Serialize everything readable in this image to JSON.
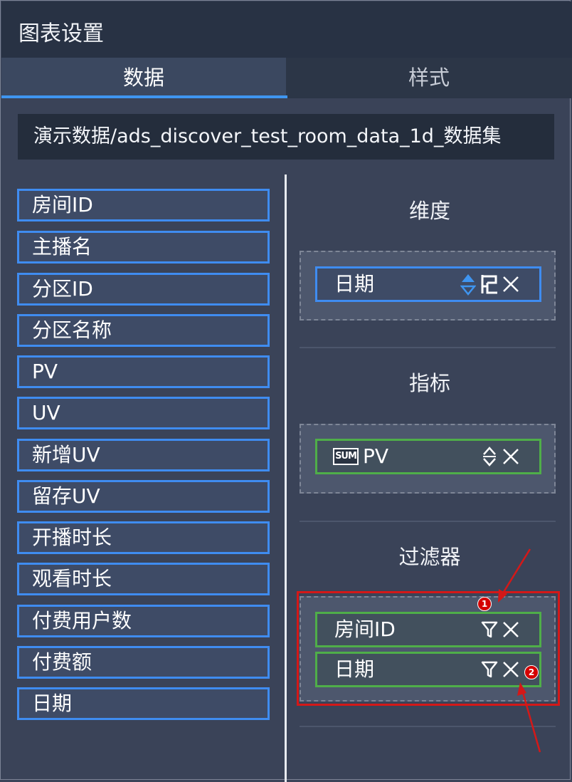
{
  "panel": {
    "title": "图表设置"
  },
  "tabs": [
    {
      "label": "数据",
      "active": true
    },
    {
      "label": "样式",
      "active": false
    }
  ],
  "dataset": {
    "name": "演示数据/ads_discover_test_room_data_1d_数据集"
  },
  "fields": [
    {
      "label": "房间ID"
    },
    {
      "label": "主播名"
    },
    {
      "label": "分区ID"
    },
    {
      "label": "分区名称"
    },
    {
      "label": "PV"
    },
    {
      "label": "UV"
    },
    {
      "label": "新增UV"
    },
    {
      "label": "留存UV"
    },
    {
      "label": "开播时长"
    },
    {
      "label": "观看时长"
    },
    {
      "label": "付费用户数"
    },
    {
      "label": "付费额"
    },
    {
      "label": "日期"
    }
  ],
  "dimensions": {
    "title": "维度",
    "items": [
      {
        "label": "日期",
        "icons": [
          "sort-icon",
          "hierarchy-icon",
          "close-icon"
        ]
      }
    ]
  },
  "metrics": {
    "title": "指标",
    "items": [
      {
        "aggregation": "SUM",
        "label": "PV",
        "icons": [
          "sort-icon",
          "close-icon"
        ]
      }
    ]
  },
  "filters": {
    "title": "过滤器",
    "items": [
      {
        "label": "房间ID",
        "icons": [
          "filter-icon",
          "close-icon"
        ]
      },
      {
        "label": "日期",
        "icons": [
          "filter-icon",
          "close-icon"
        ]
      }
    ]
  },
  "annotations": {
    "badge_1": "1",
    "badge_2": "2"
  },
  "colors": {
    "accent_blue": "#3f8cf0",
    "metric_green": "#4fae49",
    "annotation_red": "#d41818",
    "panel_bg": "#3a4358",
    "title_bg": "#283244"
  }
}
